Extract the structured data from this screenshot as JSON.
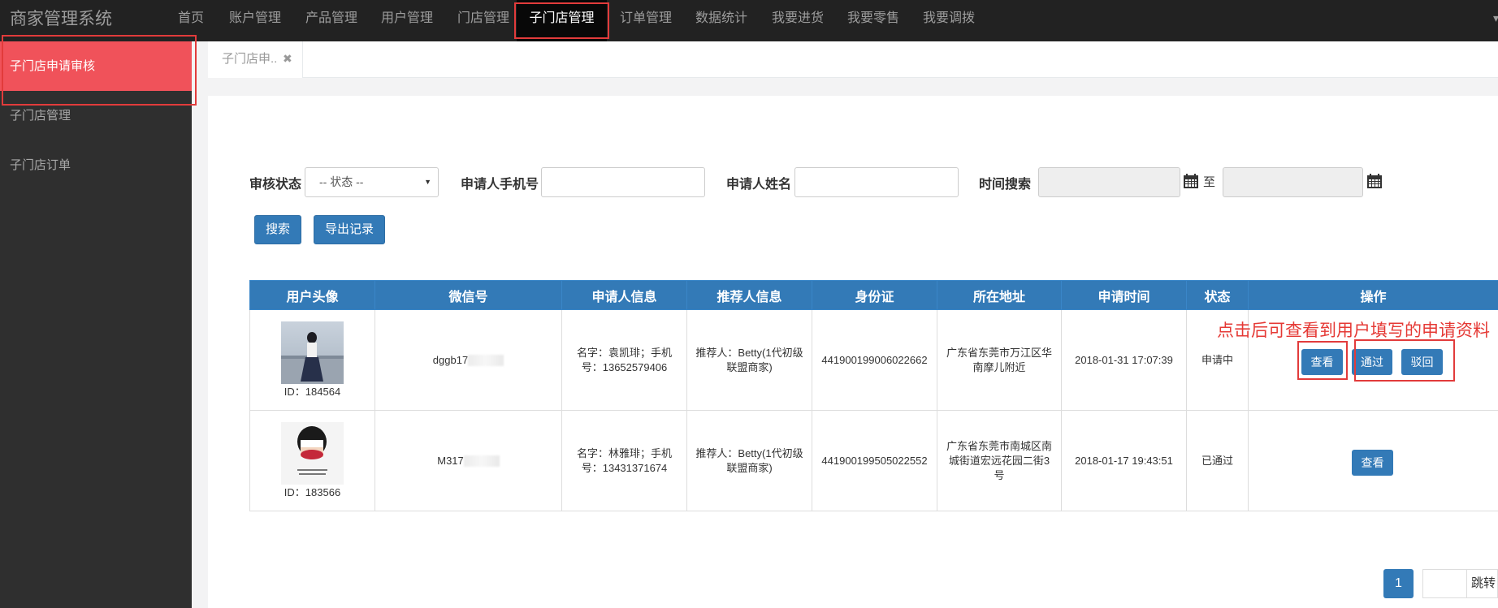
{
  "app": {
    "title": "商家管理系统"
  },
  "nav": {
    "items": [
      "首页",
      "账户管理",
      "产品管理",
      "用户管理",
      "门店管理",
      "子门店管理",
      "订单管理",
      "数据统计",
      "我要进货",
      "我要零售",
      "我要调拨"
    ],
    "active": "子门店管理"
  },
  "sidebar": {
    "items": [
      "子门店申请审核",
      "子门店管理",
      "子门店订单"
    ]
  },
  "tabs": [
    {
      "label": "子门店申..",
      "close": "✖"
    }
  ],
  "filters": {
    "status_label": "审核状态",
    "status_value": "-- 状态 --",
    "phone_label": "申请人手机号",
    "name_label": "申请人姓名",
    "time_label": "时间搜索",
    "to_label": "至"
  },
  "buttons": {
    "search": "搜索",
    "export": "导出记录"
  },
  "table": {
    "headers": [
      "用户头像",
      "微信号",
      "申请人信息",
      "推荐人信息",
      "身份证",
      "所在地址",
      "申请时间",
      "状态",
      "操作"
    ],
    "rows": [
      {
        "id": "ID：184564",
        "wechat": "dggb17",
        "applicant": "名字：袁凯琲；手机号：13652579406",
        "referrer": "推荐人：Betty(1代初级联盟商家)",
        "id_card": "441900199006022662",
        "address": "广东省东莞市万江区华南摩儿附近",
        "time": "2018-01-31 17:07:39",
        "status": "申请中",
        "actions": [
          "查看",
          "通过",
          "驳回"
        ]
      },
      {
        "id": "ID：183566",
        "wechat": "M317",
        "applicant": "名字：林雅琲；手机号：13431371674",
        "referrer": "推荐人：Betty(1代初级联盟商家)",
        "id_card": "441900199505022552",
        "address": "广东省东莞市南城区南城街道宏远花园二街3号",
        "time": "2018-01-17 19:43:51",
        "status": "已通过",
        "actions": [
          "查看"
        ]
      }
    ]
  },
  "annotation": "点击后可查看到用户填写的申请资料",
  "pagination": {
    "current": "1",
    "jump_label": "跳转"
  },
  "colors": {
    "primary": "#337ab7",
    "sidebar_active": "#f0525a",
    "annotation": "#e23b3b",
    "topbar": "#222222"
  }
}
